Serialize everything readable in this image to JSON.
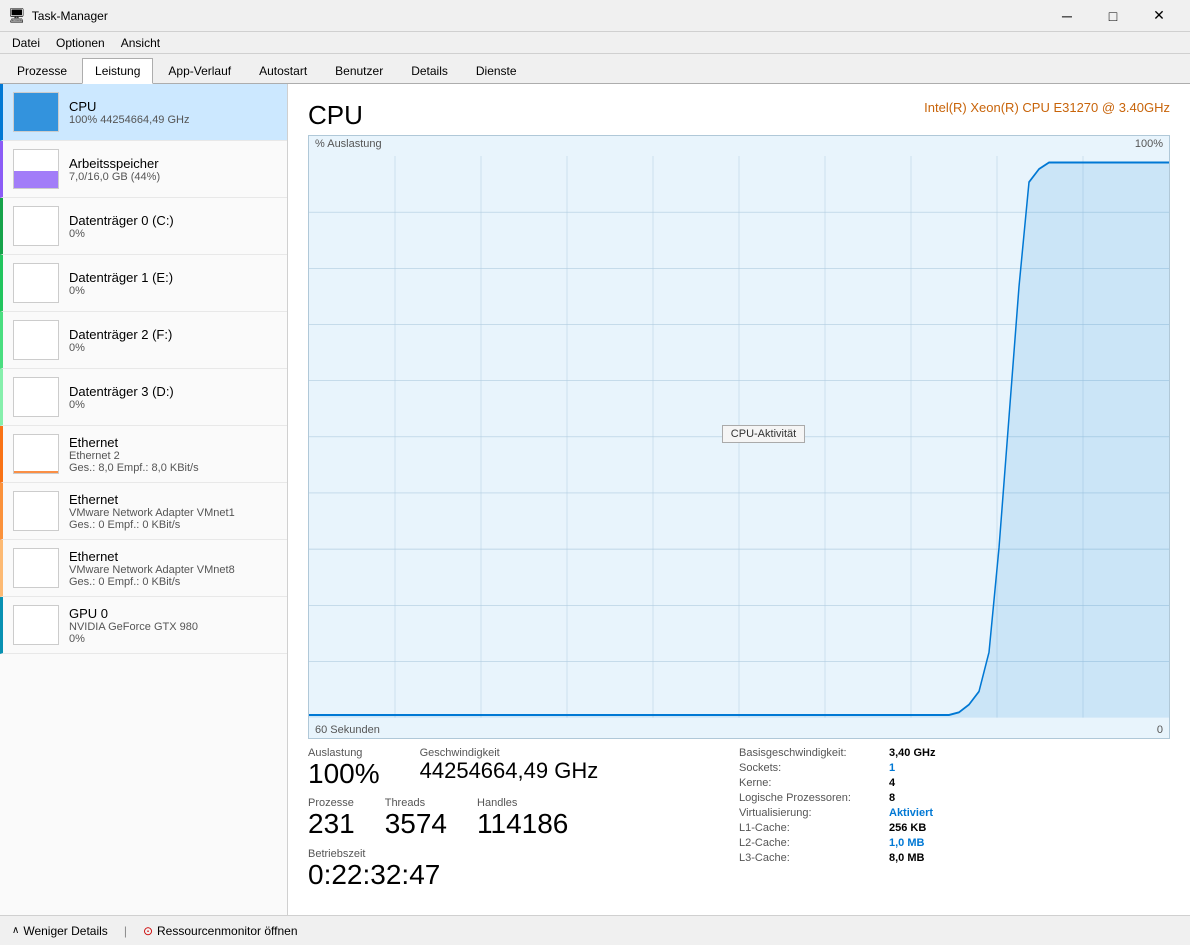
{
  "titleBar": {
    "icon": "⚙",
    "title": "Task-Manager",
    "minimize": "─",
    "maximize": "□",
    "close": "✕"
  },
  "menuBar": {
    "items": [
      "Datei",
      "Optionen",
      "Ansicht"
    ]
  },
  "tabs": {
    "items": [
      "Prozesse",
      "Leistung",
      "App-Verlauf",
      "Autostart",
      "Benutzer",
      "Details",
      "Dienste"
    ],
    "active": "Leistung"
  },
  "sidebar": {
    "items": [
      {
        "id": "cpu",
        "title": "CPU",
        "sub": "100% 44254664,49 GHz",
        "detail": "",
        "active": true,
        "barHeight": 100,
        "color": "#0078d4"
      },
      {
        "id": "memory",
        "title": "Arbeitsspeicher",
        "sub": "7,0/16,0 GB (44%)",
        "detail": "",
        "active": false,
        "barHeight": 44,
        "color": "#8b5cf6"
      },
      {
        "id": "disk0",
        "title": "Datenträger 0 (C:)",
        "sub": "0%",
        "detail": "",
        "active": false,
        "barHeight": 1,
        "color": "#16a34a"
      },
      {
        "id": "disk1",
        "title": "Datenträger 1 (E:)",
        "sub": "0%",
        "detail": "",
        "active": false,
        "barHeight": 1,
        "color": "#22c55e"
      },
      {
        "id": "disk2",
        "title": "Datenträger 2 (F:)",
        "sub": "0%",
        "detail": "",
        "active": false,
        "barHeight": 1,
        "color": "#4ade80"
      },
      {
        "id": "disk3",
        "title": "Datenträger 3 (D:)",
        "sub": "0%",
        "detail": "",
        "active": false,
        "barHeight": 1,
        "color": "#86efac"
      },
      {
        "id": "ethernet1",
        "title": "Ethernet",
        "sub": "Ethernet 2",
        "detail": "Ges.: 8,0 Empf.: 8,0 KBit/s",
        "active": false,
        "barHeight": 5,
        "color": "#f97316"
      },
      {
        "id": "ethernet2",
        "title": "Ethernet",
        "sub": "VMware Network Adapter VMnet1",
        "detail": "Ges.: 0 Empf.: 0 KBit/s",
        "active": false,
        "barHeight": 1,
        "color": "#fb923c"
      },
      {
        "id": "ethernet3",
        "title": "Ethernet",
        "sub": "VMware Network Adapter VMnet8",
        "detail": "Ges.: 0 Empf.: 0 KBit/s",
        "active": false,
        "barHeight": 1,
        "color": "#fdba74"
      },
      {
        "id": "gpu0",
        "title": "GPU 0",
        "sub": "NVIDIA GeForce GTX 980",
        "detail": "0%",
        "active": false,
        "barHeight": 1,
        "color": "#0891b2"
      }
    ]
  },
  "content": {
    "title": "CPU",
    "cpuModel": "Intel(R) Xeon(R) CPU E31270 @ 3.40GHz",
    "chartYLabel": "% Auslastung",
    "chartY100": "100%",
    "chartY0": "0",
    "chartTimeLabel": "60 Sekunden",
    "tooltip": "CPU-Aktivität",
    "stats": {
      "auslastungLabel": "Auslastung",
      "auslastungValue": "100%",
      "geschwindigkeitLabel": "Geschwindigkeit",
      "geschwindigkeitValue": "44254664,49 GHz",
      "prozesseLabel": "Prozesse",
      "prozesseValue": "231",
      "threadsLabel": "Threads",
      "threadsValue": "3574",
      "handlesLabel": "Handles",
      "handlesValue": "114186",
      "betriebszeitLabel": "Betriebszeit",
      "betriebszeitValue": "0:22:32:47"
    },
    "specs": [
      {
        "label": "Basisgeschwindigkeit:",
        "value": "3,40 GHz",
        "highlight": false
      },
      {
        "label": "Sockets:",
        "value": "1",
        "highlight": true
      },
      {
        "label": "Kerne:",
        "value": "4",
        "highlight": false
      },
      {
        "label": "Logische Prozessoren:",
        "value": "8",
        "highlight": false
      },
      {
        "label": "Virtualisierung:",
        "value": "Aktiviert",
        "highlight": true
      },
      {
        "label": "L1-Cache:",
        "value": "256 KB",
        "highlight": false
      },
      {
        "label": "L2-Cache:",
        "value": "1,0 MB",
        "highlight": true
      },
      {
        "label": "L3-Cache:",
        "value": "8,0 MB",
        "highlight": false
      }
    ]
  },
  "bottomBar": {
    "lessDetails": "Weniger Details",
    "resourceMonitor": "Ressourcenmonitor öffnen"
  }
}
